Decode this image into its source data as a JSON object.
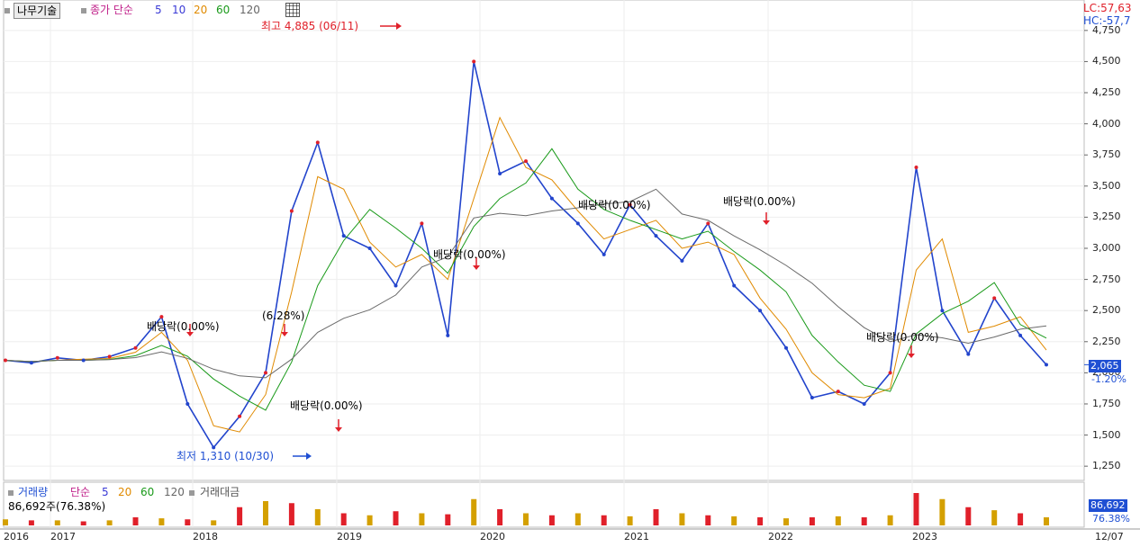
{
  "header": {
    "stock_name": "나무기술",
    "legend_label": "종가 단순",
    "ma_periods": [
      "5",
      "10",
      "20",
      "60",
      "120"
    ],
    "ma_colors": [
      "#3a3ad6",
      "#e08a00",
      "#1a9a1a",
      "#6a6a6a",
      "#333333"
    ]
  },
  "right_info": {
    "lc": "LC:57,63",
    "hc": "HC:-57,7"
  },
  "last_price": {
    "value": "2,065",
    "change": "-1.20%"
  },
  "high_label": "최고 4,885 (06/11)",
  "low_label": "최저 1,310 (10/30)",
  "annotations": [
    {
      "text": "배당락(0.00%)"
    },
    {
      "text": "(6.28%)"
    },
    {
      "text": "배당락(0.00%)"
    },
    {
      "text": "배당락(0.00%)"
    },
    {
      "text": "배당락(0.00%)"
    },
    {
      "text": "배당락(0.00%)"
    },
    {
      "text": "배당락(0.00%)"
    }
  ],
  "volume_panel": {
    "legend_label": "거래량",
    "ma_label": "단순",
    "ma_periods": [
      "5",
      "20",
      "60",
      "120"
    ],
    "extra_label": "거래대금",
    "volume_text": "86,692주(76.38%)",
    "last_volume": "86,692",
    "last_volume_pct": "76.38%"
  },
  "x_axis": {
    "labels": [
      "2016",
      "2017",
      "2018",
      "2019",
      "2020",
      "2021",
      "2022",
      "2023"
    ],
    "end_label": "12/07"
  },
  "colors": {
    "up": "#e0202a",
    "down": "#2244cc",
    "accent_blue": "#1f4fd3",
    "grid": "#e4e4e4"
  },
  "chart_data": {
    "type": "line",
    "title": "",
    "xlabel": "",
    "ylabel": "",
    "ylim": [
      1150,
      4850
    ],
    "yticks": [
      "1,250",
      "1,500",
      "1,750",
      "2,000",
      "2,250",
      "2,500",
      "2,750",
      "3,000",
      "3,250",
      "3,500",
      "3,750",
      "4,000",
      "4,250",
      "4,500",
      "4,750"
    ],
    "x": [
      "2016-12",
      "2017-06",
      "2017-12",
      "2018-06",
      "2018-09",
      "2018-10",
      "2018-11",
      "2019-01",
      "2019-03",
      "2019-05",
      "2019-06",
      "2019-07",
      "2019-09",
      "2019-11",
      "2020-01",
      "2020-03",
      "2020-04",
      "2020-05",
      "2020-06",
      "2020-08",
      "2020-10",
      "2020-12",
      "2021-02",
      "2021-04",
      "2021-06",
      "2021-08",
      "2021-10",
      "2021-12",
      "2022-02",
      "2022-04",
      "2022-06",
      "2022-08",
      "2022-10",
      "2022-12",
      "2023-01",
      "2023-02",
      "2023-04",
      "2023-06",
      "2023-08",
      "2023-10",
      "2023-12"
    ],
    "series": [
      {
        "values": [
          2100,
          2080,
          2120,
          2100,
          2130,
          2200,
          2450,
          1750,
          1400,
          1650,
          2000,
          3300,
          3850,
          3100,
          3000,
          2700,
          3200,
          2300,
          4500,
          3600,
          3700,
          3400,
          3200,
          2950,
          3350,
          3100,
          2900,
          3200,
          2700,
          2500,
          2200,
          1800,
          1850,
          1750,
          2000,
          3650,
          2500,
          2150,
          2600,
          2300,
          2065
        ]
      }
    ],
    "volume_values": [
      0.6,
      0.5,
      0.5,
      0.4,
      0.5,
      0.8,
      0.7,
      0.6,
      0.5,
      1.8,
      2.4,
      2.2,
      1.6,
      1.2,
      1.0,
      1.4,
      1.2,
      1.1,
      2.6,
      1.6,
      1.2,
      1.0,
      1.2,
      1.0,
      0.9,
      1.6,
      1.2,
      1.0,
      0.9,
      0.8,
      0.7,
      0.8,
      0.9,
      0.8,
      1.0,
      3.2,
      2.6,
      1.8,
      1.5,
      1.2,
      0.8
    ]
  }
}
